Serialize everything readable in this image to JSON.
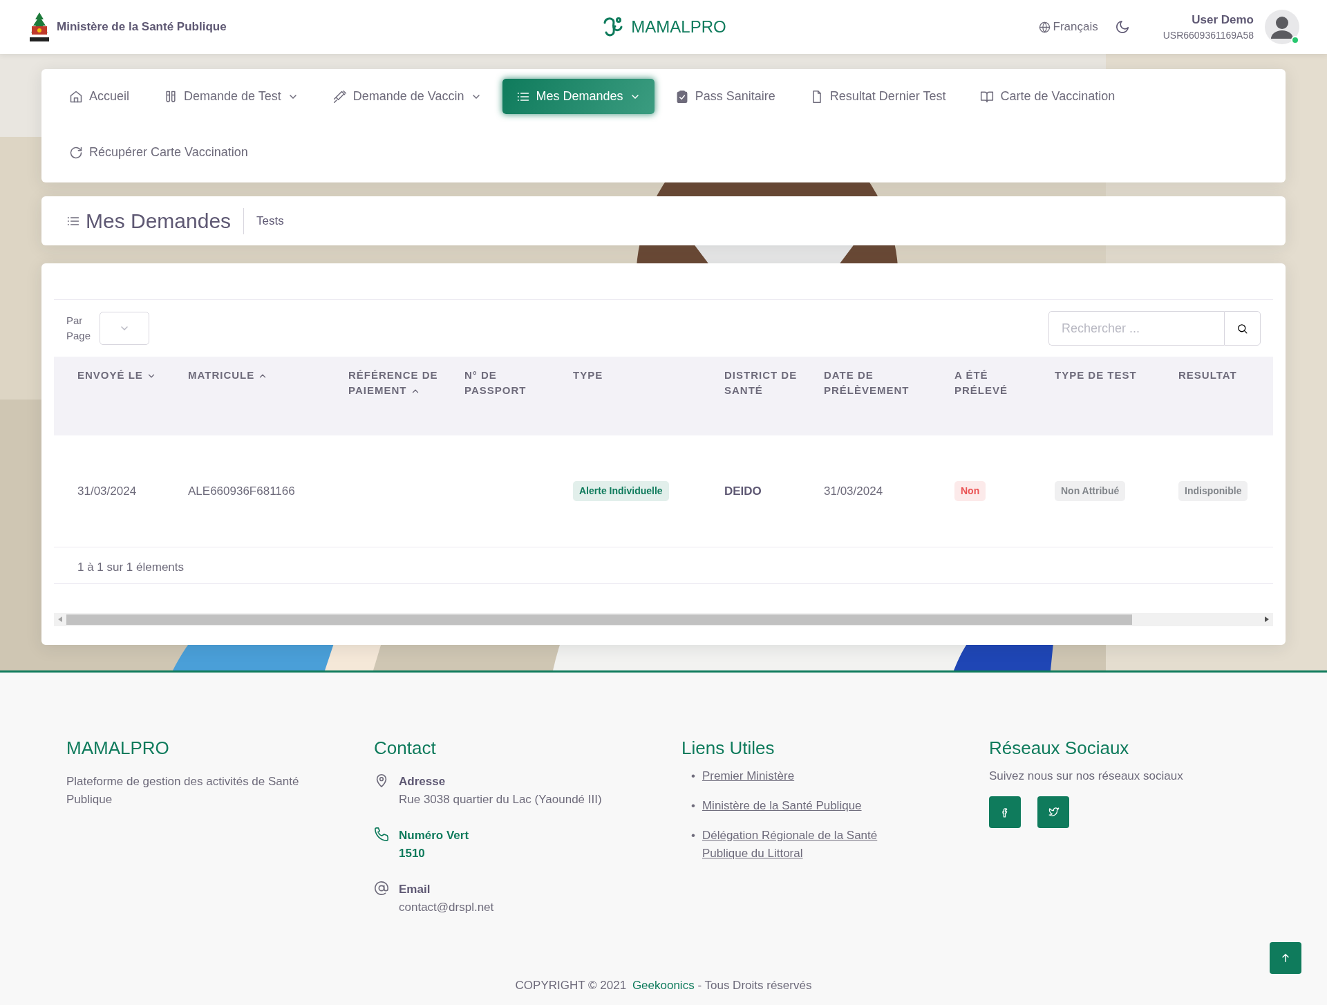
{
  "header": {
    "ministry": "Ministère de la Santé Publique",
    "app_name": "MAMALPRO",
    "language": "Français",
    "user_name": "User Demo",
    "user_id": "USR6609361169A58",
    "online": true
  },
  "nav": [
    {
      "label": "Accueil",
      "dropdown": false,
      "selected": false
    },
    {
      "label": "Demande de Test",
      "dropdown": true,
      "selected": false
    },
    {
      "label": "Demande de Vaccin",
      "dropdown": true,
      "selected": false
    },
    {
      "label": "Mes Demandes",
      "dropdown": true,
      "selected": true
    },
    {
      "label": "Pass Sanitaire",
      "dropdown": false,
      "selected": false
    },
    {
      "label": "Resultat Dernier Test",
      "dropdown": false,
      "selected": false
    },
    {
      "label": "Carte de Vaccination",
      "dropdown": false,
      "selected": false
    },
    {
      "label": "Récupérer Carte Vaccination",
      "dropdown": false,
      "selected": false
    }
  ],
  "page_title": "Mes Demandes",
  "breadcrumb": "Tests",
  "per_page_label": "Par Page",
  "search": {
    "placeholder": "Rechercher ..."
  },
  "table": {
    "columns": [
      {
        "label": "ENVOYÉ LE",
        "sorted": true,
        "descending": true
      },
      {
        "label": "MATRICULE",
        "sorted": true,
        "descending": false
      },
      {
        "label": "RÉFÉRENCE DE PAIEMENT",
        "sorted": true,
        "descending": false
      },
      {
        "label": "N° DE PASSPORT",
        "sorted": false
      },
      {
        "label": "TYPE",
        "sorted": false
      },
      {
        "label": "DISTRICT DE SANTÉ",
        "sorted": false
      },
      {
        "label": "DATE DE PRÉLÈVEMENT",
        "sorted": false
      },
      {
        "label": "A ÉTÉ PRÉLEVÉ",
        "sorted": false
      },
      {
        "label": "TYPE DE TEST",
        "sorted": false
      },
      {
        "label": "RESULTAT",
        "sorted": false
      }
    ],
    "rows": [
      [
        {
          "kind": "text",
          "text": "31/03/2024"
        },
        {
          "kind": "text",
          "text": "ALE660936F681166"
        },
        {
          "kind": "empty"
        },
        {
          "kind": "empty"
        },
        {
          "kind": "badge",
          "color": "#0f7b5c",
          "text": "Alerte Individuelle"
        },
        {
          "kind": "bold",
          "text": "DEIDO"
        },
        {
          "kind": "text",
          "text": "31/03/2024"
        },
        {
          "kind": "badge",
          "color": "#ea5455",
          "text": "Non"
        },
        {
          "kind": "badge",
          "color": "#82868b",
          "text": "Non Attribué"
        },
        {
          "kind": "badge",
          "color": "#82868b",
          "text": "Indisponible"
        }
      ]
    ],
    "summary": "1 à 1 sur 1 élements"
  },
  "footer": {
    "about": {
      "title": "MAMALPRO",
      "text": "Plateforme de gestion des activités de Santé Publique"
    },
    "contact": {
      "title": "Contact",
      "items": [
        {
          "label": "Adresse",
          "value": "Rue 3038 quartier du Lac (Yaoundé III)",
          "highlight": false
        },
        {
          "label": "Numéro Vert",
          "value": "1510",
          "highlight": true
        },
        {
          "label": "Email",
          "value": "contact@drspl.net",
          "highlight": false
        }
      ]
    },
    "links": {
      "title": "Liens Utiles",
      "items": [
        {
          "bullet": "•",
          "label": "Premier Ministère"
        },
        {
          "bullet": "•",
          "label": "Ministère de la Santé Publique"
        },
        {
          "bullet": "•",
          "label": "Délégation Régionale de la Santé Publique du Littoral"
        }
      ]
    },
    "social": {
      "title": "Réseaux Sociaux",
      "text": "Suivez nous sur nos réseaux sociaux"
    },
    "copyright": "COPYRIGHT © 2021",
    "company": "Geekoonics",
    "rights": "- Tous Droits réservés"
  }
}
